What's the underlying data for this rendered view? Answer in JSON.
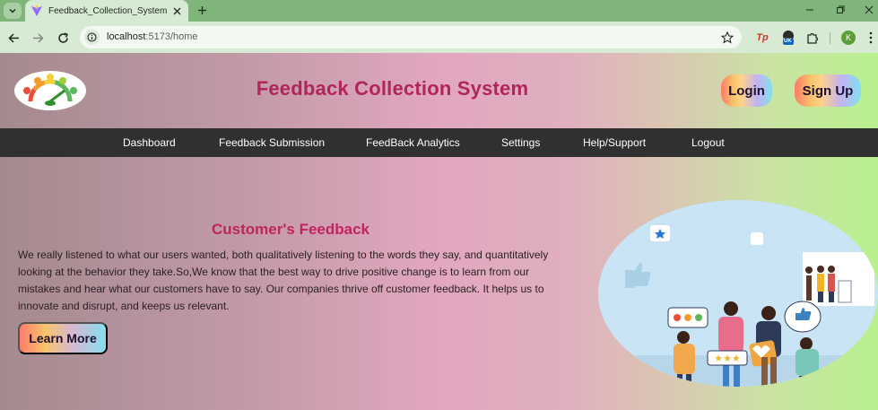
{
  "browser": {
    "tab_title": "Feedback_Collection_System",
    "url_host": "localhost",
    "url_path": ":5173/home",
    "profile_initial": "K",
    "extension_tp": "Tp",
    "extension_badge": "UK"
  },
  "header": {
    "title": "Feedback Collection System",
    "login_label": "Login",
    "signup_label": "Sign Up"
  },
  "nav": {
    "items": [
      "Dashboard",
      "Feedback Submission",
      "FeedBack Analytics",
      "Settings",
      "Help/Support",
      "Logout"
    ]
  },
  "hero": {
    "heading": "Customer's Feedback",
    "text": "We really listened to what our users wanted, both qualitatively listening to the words they say, and quantitatively looking at the behavior they take.So,We know that the best way to drive positive change is to learn from our mistakes and hear what our customers have to say. Our companies thrive off customer feedback. It helps us to innovate and disrupt, and keeps us relevant.",
    "button_label": "Learn More",
    "illustration_rating": "★★★"
  },
  "colors": {
    "title": "#b0265a",
    "heading": "#c0245f",
    "navbar": "#303030",
    "tabbar": "#7fb47a"
  }
}
